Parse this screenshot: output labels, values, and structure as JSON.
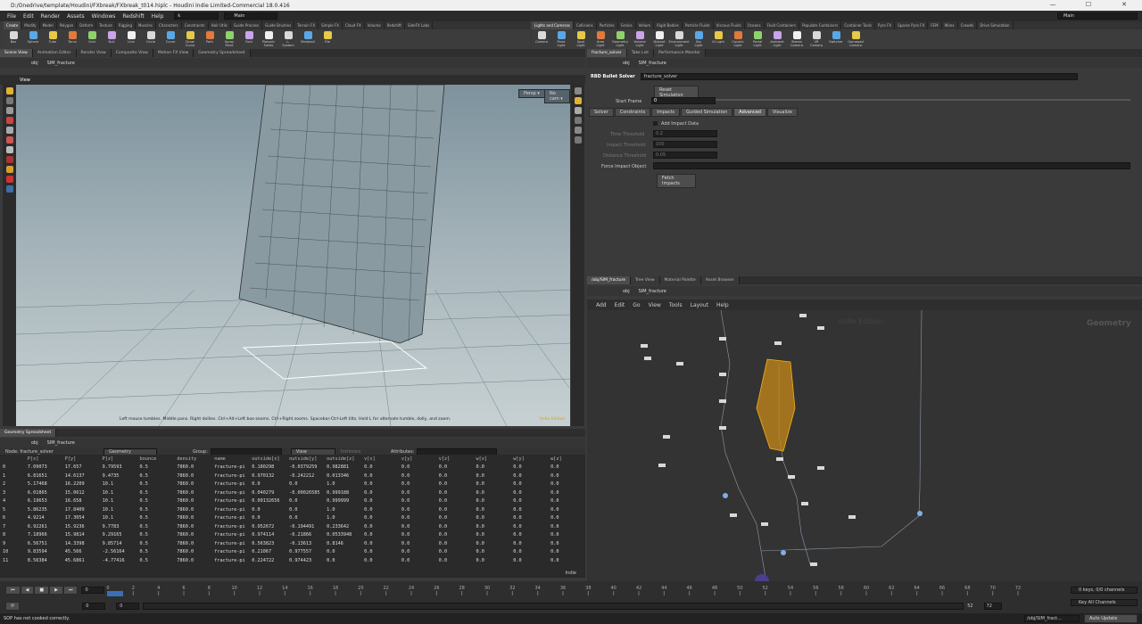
{
  "title": "D:/Onedrive/template/Houdini/FXbreak/FXbreak_t014.hiplc - Houdini Indie Limited-Commercial 18.0.416",
  "menu": [
    "File",
    "Edit",
    "Render",
    "Assets",
    "Windows",
    "Redshift",
    "Help"
  ],
  "menu_search": "k",
  "desktop": "Main",
  "desktop_right": "Main",
  "shelf_left_tabs": [
    "Create",
    "Modify",
    "Model",
    "Polygon",
    "Deform",
    "Texture",
    "Rigging",
    "Muscles",
    "Characters",
    "Constraints",
    "Hair Utils",
    "Guide Process",
    "Guide Brushes",
    "Terrain FX",
    "Simple FX",
    "Cloud FX",
    "Volume",
    "Redshift",
    "SideFX Labs"
  ],
  "shelf_left_tools": [
    "Box",
    "Sphere",
    "Tube",
    "Torus",
    "Grid",
    "Null",
    "Line",
    "Circle",
    "Curve",
    "Draw Curve",
    "Path",
    "Spray Paint",
    "Font",
    "Platonic Solids",
    "L-System",
    "Metaball",
    "File"
  ],
  "shelf_right_tabs": [
    "Lights and Cameras",
    "Collisions",
    "Particles",
    "Grains",
    "Vellum",
    "Rigid Bodies",
    "Particle Fluids",
    "Viscous Fluids",
    "Oceans",
    "Fluid Containers",
    "Populate Containers",
    "Container Tools",
    "Pyro FX",
    "Sparse Pyro FX",
    "FEM",
    "Wires",
    "Crowds",
    "Drive Simulation"
  ],
  "shelf_right_tools": [
    "Camera",
    "Point Light",
    "Spot Light",
    "Area Light",
    "Geometry Light",
    "Volume Light",
    "Distant Light",
    "Environment Light",
    "Sky Light",
    "GI Light",
    "Caustic Light",
    "Portal Light",
    "Ambient Light",
    "Stereo Camera",
    "VR Camera",
    "Switcher",
    "Gamepad Camera"
  ],
  "left_pane_tabs": [
    "Scene View",
    "Animation Editor",
    "Render View",
    "Composite View",
    "Motion FX View",
    "Geometry Spreadsheet"
  ],
  "path_obj": "obj",
  "path_node": "SIM_fracture",
  "viewport": {
    "label": "View",
    "persp": "Persp ▾",
    "cam": "No cam ▾",
    "hint": "Left mouse tumbles. Middle pans. Right dollies. Ctrl+Alt+Left box-zooms. Ctrl+Right zooms. Spacebar-Ctrl-Left tilts. Hold L for alternate tumble, dolly, and zoom.",
    "watermark": "Indie Edition"
  },
  "sheet": {
    "tab": "Geometry Spreadsheet",
    "node": "Node: fracture_solver",
    "mode": "Geometry",
    "group_label": "Group:",
    "view": "View",
    "intrinsics": "Intrinsics",
    "attributes_label": "Attributes:",
    "headers": [
      "",
      "P[x]",
      "P[y]",
      "P[z]",
      "bounce",
      "density",
      "name",
      "outside[x]",
      "outside[y]",
      "outside[z]",
      "v[x]",
      "v[y]",
      "v[z]",
      "w[x]",
      "w[y]",
      "w[z]"
    ],
    "rows": [
      [
        "0",
        "7.09073",
        "17.657",
        "9.79593",
        "0.5",
        "7860.0",
        "fracture-pi",
        "0.180298",
        "-0.0379259",
        "0.982881",
        "0.0",
        "0.0",
        "0.0",
        "0.0",
        "0.0",
        "0.0"
      ],
      [
        "1",
        "6.81651",
        "14.6137",
        "9.4735",
        "0.5",
        "7860.0",
        "fracture-pi",
        "0.970132",
        "-0.242212",
        "0.013346",
        "0.0",
        "0.0",
        "0.0",
        "0.0",
        "0.0",
        "0.0"
      ],
      [
        "2",
        "5.17468",
        "16.2209",
        "10.1",
        "0.5",
        "7860.0",
        "fracture-pi",
        "0.0",
        "0.0",
        "1.0",
        "0.0",
        "0.0",
        "0.0",
        "0.0",
        "0.0",
        "0.0"
      ],
      [
        "3",
        "6.01865",
        "15.0612",
        "10.1",
        "0.5",
        "7860.0",
        "fracture-pi",
        "0.040279",
        "-0.00026585",
        "0.999188",
        "0.0",
        "0.0",
        "0.0",
        "0.0",
        "0.0",
        "0.0"
      ],
      [
        "4",
        "6.19653",
        "16.658",
        "10.1",
        "0.5",
        "7860.0",
        "fracture-pi",
        "0.00132656",
        "0.0",
        "0.999999",
        "0.0",
        "0.0",
        "0.0",
        "0.0",
        "0.0",
        "0.0"
      ],
      [
        "5",
        "5.86235",
        "17.8409",
        "10.1",
        "0.5",
        "7860.0",
        "fracture-pi",
        "0.0",
        "0.0",
        "1.0",
        "0.0",
        "0.0",
        "0.0",
        "0.0",
        "0.0",
        "0.0"
      ],
      [
        "6",
        "4.9214",
        "17.3054",
        "10.1",
        "0.5",
        "7860.0",
        "fracture-pi",
        "0.0",
        "0.0",
        "1.0",
        "0.0",
        "0.0",
        "0.0",
        "0.0",
        "0.0",
        "0.0"
      ],
      [
        "7",
        "6.92261",
        "15.9236",
        "9.7783",
        "0.5",
        "7860.0",
        "fracture-pi",
        "0.952672",
        "-0.194491",
        "0.233642",
        "0.0",
        "0.0",
        "0.0",
        "0.0",
        "0.0",
        "0.0"
      ],
      [
        "8",
        "7.18966",
        "15.9814",
        "9.29165",
        "0.5",
        "7860.0",
        "fracture-pi",
        "0.974114",
        "-0.21866",
        "0.0533948",
        "0.0",
        "0.0",
        "0.0",
        "0.0",
        "0.0",
        "0.0"
      ],
      [
        "9",
        "6.56751",
        "14.3398",
        "9.85714",
        "0.5",
        "7860.0",
        "fracture-pi",
        "0.563823",
        "-0.13613",
        "0.8146",
        "0.0",
        "0.0",
        "0.0",
        "0.0",
        "0.0",
        "0.0"
      ],
      [
        "10",
        "9.83594",
        "45.566",
        "-2.56164",
        "0.5",
        "7860.0",
        "fracture-pi",
        "0.21067",
        "0.977557",
        "0.0",
        "0.0",
        "0.0",
        "0.0",
        "0.0",
        "0.0",
        "0.0"
      ],
      [
        "11",
        "8.56384",
        "45.6861",
        "-4.77416",
        "0.5",
        "7860.0",
        "fracture-pi",
        "0.224722",
        "0.974423",
        "0.0",
        "0.0",
        "0.0",
        "0.0",
        "0.0",
        "0.0",
        "0.0"
      ]
    ],
    "corner": "Indie"
  },
  "right_top_tabs": [
    "fracture_solver",
    "Take List",
    "Performance Monitor"
  ],
  "params": {
    "type": "RBD Bullet Solver",
    "name": "fracture_solver",
    "reset": "Reset Simulation",
    "start_frame_label": "Start Frame",
    "start_frame": "0",
    "tabs": [
      "Solver",
      "Constraints",
      "Impacts",
      "Guided Simulation",
      "Advanced",
      "Visualize"
    ],
    "add_impact": "Add Impact Data",
    "time_thr_label": "Time Threshold",
    "time_thr": "0.2",
    "impact_thr_label": "Impact Threshold",
    "impact_thr": "100",
    "dist_thr_label": "Distance Threshold",
    "dist_thr": "0.05",
    "force_label": "Force Impact Object",
    "fetch": "Fetch Impacts"
  },
  "right_bottom_tabs": [
    "/obj/SIM_fracture",
    "Tree View",
    "Material Palette",
    "Asset Browser"
  ],
  "net_menu": [
    "Add",
    "Edit",
    "Go",
    "View",
    "Tools",
    "Layout",
    "Help"
  ],
  "net_watermark": "Indie Edition",
  "net_context": "Geometry",
  "timeline": {
    "ticks": [
      "0",
      "2",
      "4",
      "6",
      "8",
      "10",
      "12",
      "14",
      "16",
      "18",
      "20",
      "22",
      "24",
      "26",
      "28",
      "30",
      "32",
      "34",
      "36",
      "38",
      "40",
      "42",
      "44",
      "46",
      "48",
      "50",
      "52",
      "54",
      "56",
      "58",
      "60",
      "62",
      "64",
      "66",
      "68",
      "70",
      "72"
    ],
    "frame": "0",
    "start": "0",
    "end": "0",
    "range_end_a": "52",
    "range_end_b": "72",
    "keys": "0 keys, 0/0 channels",
    "keychannels": "Key All Channels",
    "status": "SOP has not cooked correctly.",
    "status_path": "/obj/SIM_fract...",
    "auto_update": "Auto Update"
  },
  "colors": {
    "accent": "#f2b01e",
    "node_selected": "#c88a1a",
    "viewport_top": "#7d929d",
    "viewport_bottom": "#c7d1d3"
  }
}
